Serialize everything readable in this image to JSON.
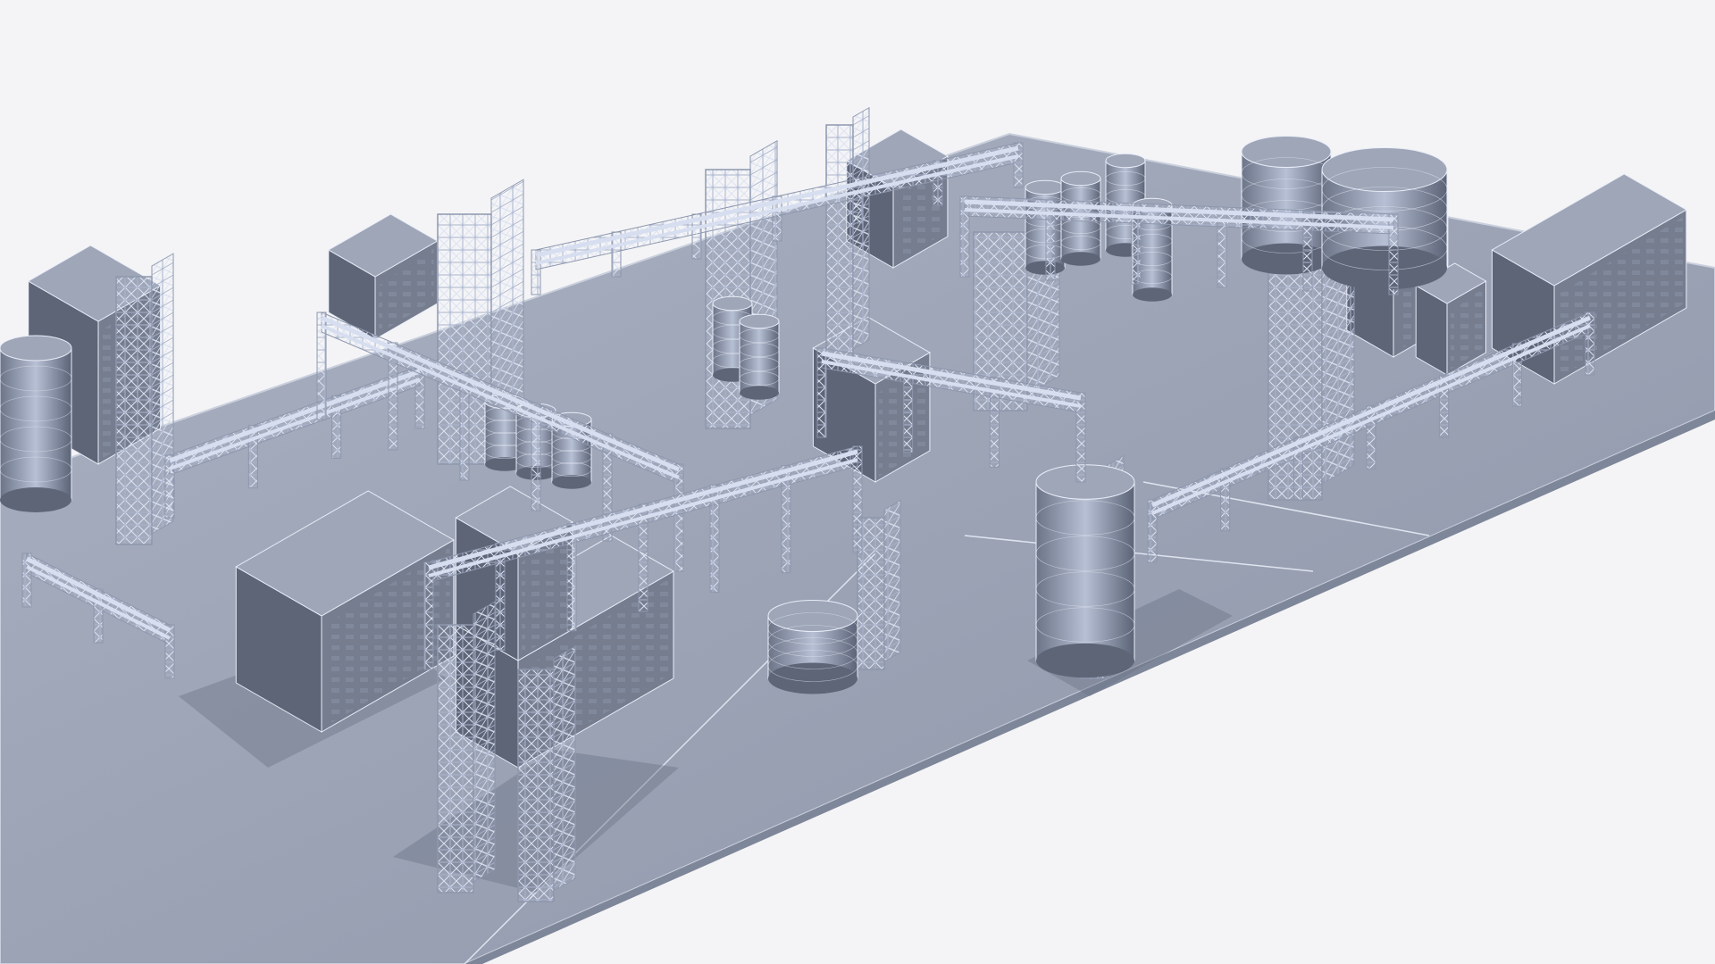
{
  "scene": {
    "subject": "isometric-industrial-plant-wireframe-model",
    "colors": {
      "background": "#f4f4f6",
      "ground": "#9aa2b4",
      "ground_edge": "#c9cfdc",
      "shadow": "#6d7587",
      "box_top": "#9ea6b8",
      "box_left": "#5d6577",
      "box_right": "#757d8f",
      "steel": "#c6d0e6",
      "steel_dark": "#8d97ad",
      "pipe": "#d6def0",
      "wire": "#e9edf7"
    }
  }
}
